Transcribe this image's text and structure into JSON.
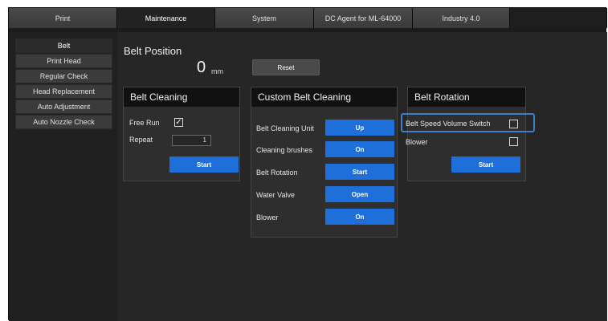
{
  "tabs": [
    {
      "label": "Print",
      "active": false
    },
    {
      "label": "Maintenance",
      "active": true
    },
    {
      "label": "System",
      "active": false
    },
    {
      "label": "DC Agent for ML-64000",
      "active": false
    },
    {
      "label": "Industry 4.0",
      "active": false
    }
  ],
  "sidebar": {
    "items": [
      {
        "label": "Belt",
        "active": true
      },
      {
        "label": "Print Head",
        "active": false
      },
      {
        "label": "Regular Check",
        "active": false
      },
      {
        "label": "Head Replacement",
        "active": false
      },
      {
        "label": "Auto Adjustment",
        "active": false
      },
      {
        "label": "Auto Nozzle Check",
        "active": false
      }
    ]
  },
  "belt_position": {
    "title": "Belt Position",
    "value": "0",
    "unit": "mm",
    "reset_label": "Reset"
  },
  "belt_cleaning": {
    "title": "Belt Cleaning",
    "free_run_label": "Free Run",
    "free_run_checked": true,
    "free_run_mark": "✓",
    "repeat_label": "Repeat",
    "repeat_value": "1",
    "start_label": "Start"
  },
  "custom_belt_cleaning": {
    "title": "Custom Belt Cleaning",
    "rows": [
      {
        "label": "Belt Cleaning Unit",
        "button": "Up"
      },
      {
        "label": "Cleaning brushes",
        "button": "On"
      },
      {
        "label": "Belt Rotation",
        "button": "Start"
      },
      {
        "label": "Water Valve",
        "button": "Open"
      },
      {
        "label": "Blower",
        "button": "On"
      }
    ]
  },
  "belt_rotation": {
    "title": "Belt Rotation",
    "speed_switch_label": "Belt Speed Volume Switch",
    "speed_switch_checked": false,
    "blower_label": "Blower",
    "blower_checked": false,
    "start_label": "Start"
  },
  "colors": {
    "accent_blue": "#1e6fd9",
    "highlight": "#3e7fc9",
    "background": "#262626"
  }
}
